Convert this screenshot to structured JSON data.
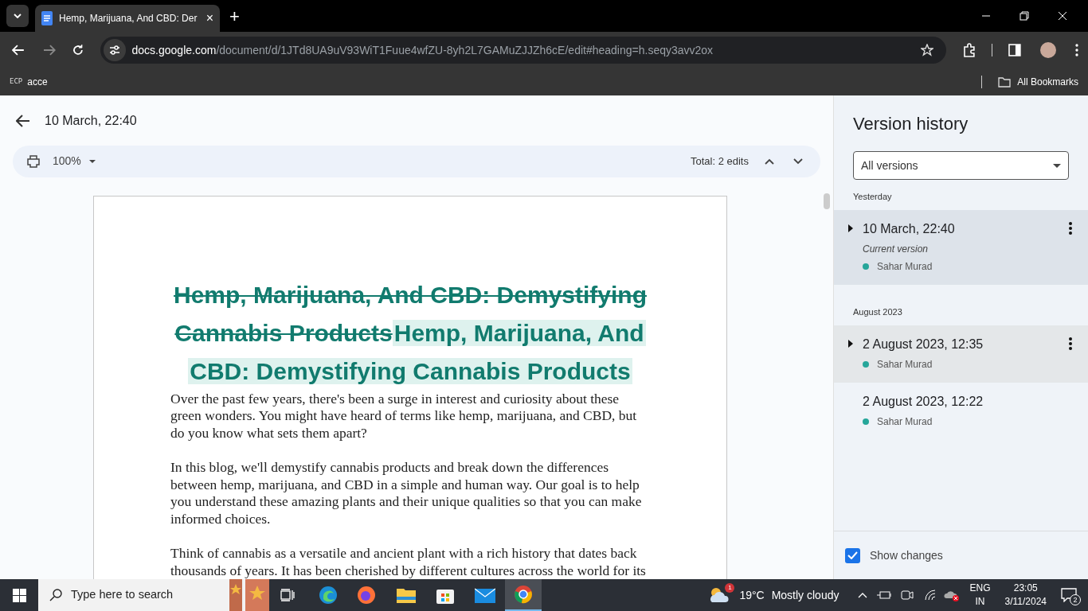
{
  "browser": {
    "tab": {
      "title": "Hemp, Marijuana, And CBD: Der",
      "close": "×"
    },
    "new_tab": "+",
    "url_host": "docs.google.com",
    "url_path": "/document/d/1JTd8UA9uV93WiT1Fuue4wfZU-8yh2L7GAMuZJJZh6cE/edit#heading=h.seqy3avv2ox",
    "bookmarks": [
      {
        "icon_text": "ECP",
        "label": "acce"
      }
    ],
    "all_bookmarks": "All Bookmarks"
  },
  "header": {
    "title": "10 March, 22:40"
  },
  "toolbar": {
    "zoom": "100%",
    "total": "Total: 2 edits"
  },
  "document": {
    "heading": [
      {
        "kind": "deleted",
        "text": "Hemp, Marijuana, And CBD: Demystifying Cannabis Products"
      },
      {
        "kind": "inserted",
        "text": "Hemp, Marijuana, And CBD: Demystifying Cannabis Products"
      }
    ],
    "paragraphs": [
      "Over the past few years, there's been a surge in interest and curiosity about these green wonders. You might have heard of terms like hemp, marijuana, and CBD, but do you know what sets them apart?",
      "In this blog, we'll demystify cannabis products and break down the differences between hemp, marijuana, and CBD in a simple and human way. Our goal is to help you understand these amazing plants and their unique qualities so that you can make informed choices.",
      "Think of cannabis as a versatile and ancient plant with a rich history that dates back thousands of years. It has been cherished by different cultures across the world for its"
    ]
  },
  "version_history": {
    "title": "Version history",
    "filter": "All versions",
    "groups": [
      {
        "label": "Yesterday",
        "versions": [
          {
            "date": "10 March, 22:40",
            "note": "Current version",
            "author": "Sahar Murad",
            "color": "#26a69a",
            "selected": true,
            "hovered": false,
            "expandable": true,
            "menu": true
          }
        ]
      },
      {
        "label": "August 2023",
        "versions": [
          {
            "date": "2 August 2023, 12:35",
            "author": "Sahar Murad",
            "color": "#26a69a",
            "selected": false,
            "hovered": true,
            "expandable": true,
            "menu": true
          },
          {
            "date": "2 August 2023, 12:22",
            "author": "Sahar Murad",
            "color": "#26a69a",
            "selected": false,
            "hovered": false,
            "expandable": false,
            "menu": false
          }
        ]
      }
    ],
    "show_changes": {
      "label": "Show changes",
      "checked": true
    }
  },
  "taskbar": {
    "search_placeholder": "Type here to search",
    "temperature": "19°C",
    "weather": "Mostly cloudy",
    "weather_badge": "1",
    "language": "ENG",
    "region": "IN",
    "time": "23:05",
    "date": "3/11/2024",
    "notifications": "2"
  }
}
